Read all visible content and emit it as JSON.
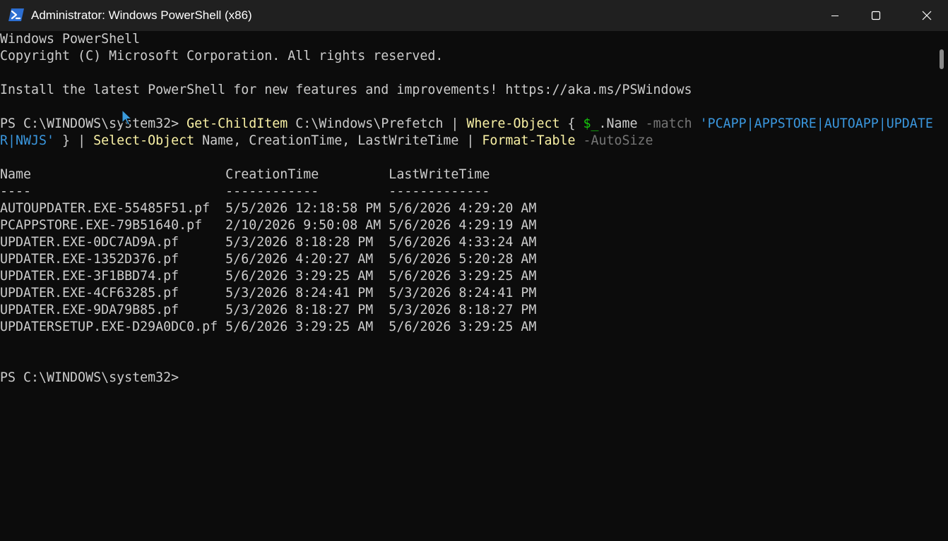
{
  "window": {
    "title": "Administrator: Windows PowerShell (x86)",
    "icon": "powershell-icon",
    "controls": [
      "minimize-icon",
      "maximize-icon",
      "close-icon"
    ]
  },
  "terminal": {
    "banner_1": "Windows PowerShell",
    "banner_2": "Copyright (C) Microsoft Corporation. All rights reserved.",
    "banner_3": "Install the latest PowerShell for new features and improvements! https://aka.ms/PSWindows",
    "command": {
      "prompt": "PS C:\\WINDOWS\\system32> ",
      "t1": "Get-ChildItem",
      "t2": " C:\\Windows\\Prefetch | ",
      "t3": "Where-Object",
      "t4": " { ",
      "t5": "$_",
      "t6": ".Name ",
      "t7": "-match",
      "t8": " ",
      "t9": "'PCAPP|APPSTORE|AUTOAPP|UPDATE",
      "t10": "R|NWJS'",
      "t11": " } | ",
      "t12": "Select-Object",
      "t13": " Name, CreationTime, LastWriteTime | ",
      "t14": "Format-Table",
      "t15": " ",
      "t16": "-AutoSize"
    },
    "table": {
      "header": "Name                         CreationTime         LastWriteTime",
      "separator": "----                         ------------         -------------",
      "rows": [
        "AUTOUPDATER.EXE-55485F51.pf  5/5/2026 12:18:58 PM 5/6/2026 4:29:20 AM",
        "PCAPPSTORE.EXE-79B51640.pf   2/10/2026 9:50:08 AM 5/6/2026 4:29:19 AM",
        "UPDATER.EXE-0DC7AD9A.pf      5/3/2026 8:18:28 PM  5/6/2026 4:33:24 AM",
        "UPDATER.EXE-1352D376.pf      5/6/2026 4:20:27 AM  5/6/2026 5:20:28 AM",
        "UPDATER.EXE-3F1BBD74.pf      5/6/2026 3:29:25 AM  5/6/2026 3:29:25 AM",
        "UPDATER.EXE-4CF63285.pf      5/3/2026 8:24:41 PM  5/3/2026 8:24:41 PM",
        "UPDATER.EXE-9DA79B85.pf      5/3/2026 8:18:27 PM  5/3/2026 8:18:27 PM",
        "UPDATERSETUP.EXE-D29A0DC0.pf 5/6/2026 3:29:25 AM  5/6/2026 3:29:25 AM"
      ]
    },
    "final_prompt": "PS C:\\WINDOWS\\system32>"
  },
  "colors": {
    "background": "#0c0c0c",
    "titlebar": "#202020",
    "text": "#cccccc",
    "cmdlet": "#f9f1a5",
    "parameter": "#767676",
    "string": "#3a96dd",
    "variable": "#16c60c"
  }
}
